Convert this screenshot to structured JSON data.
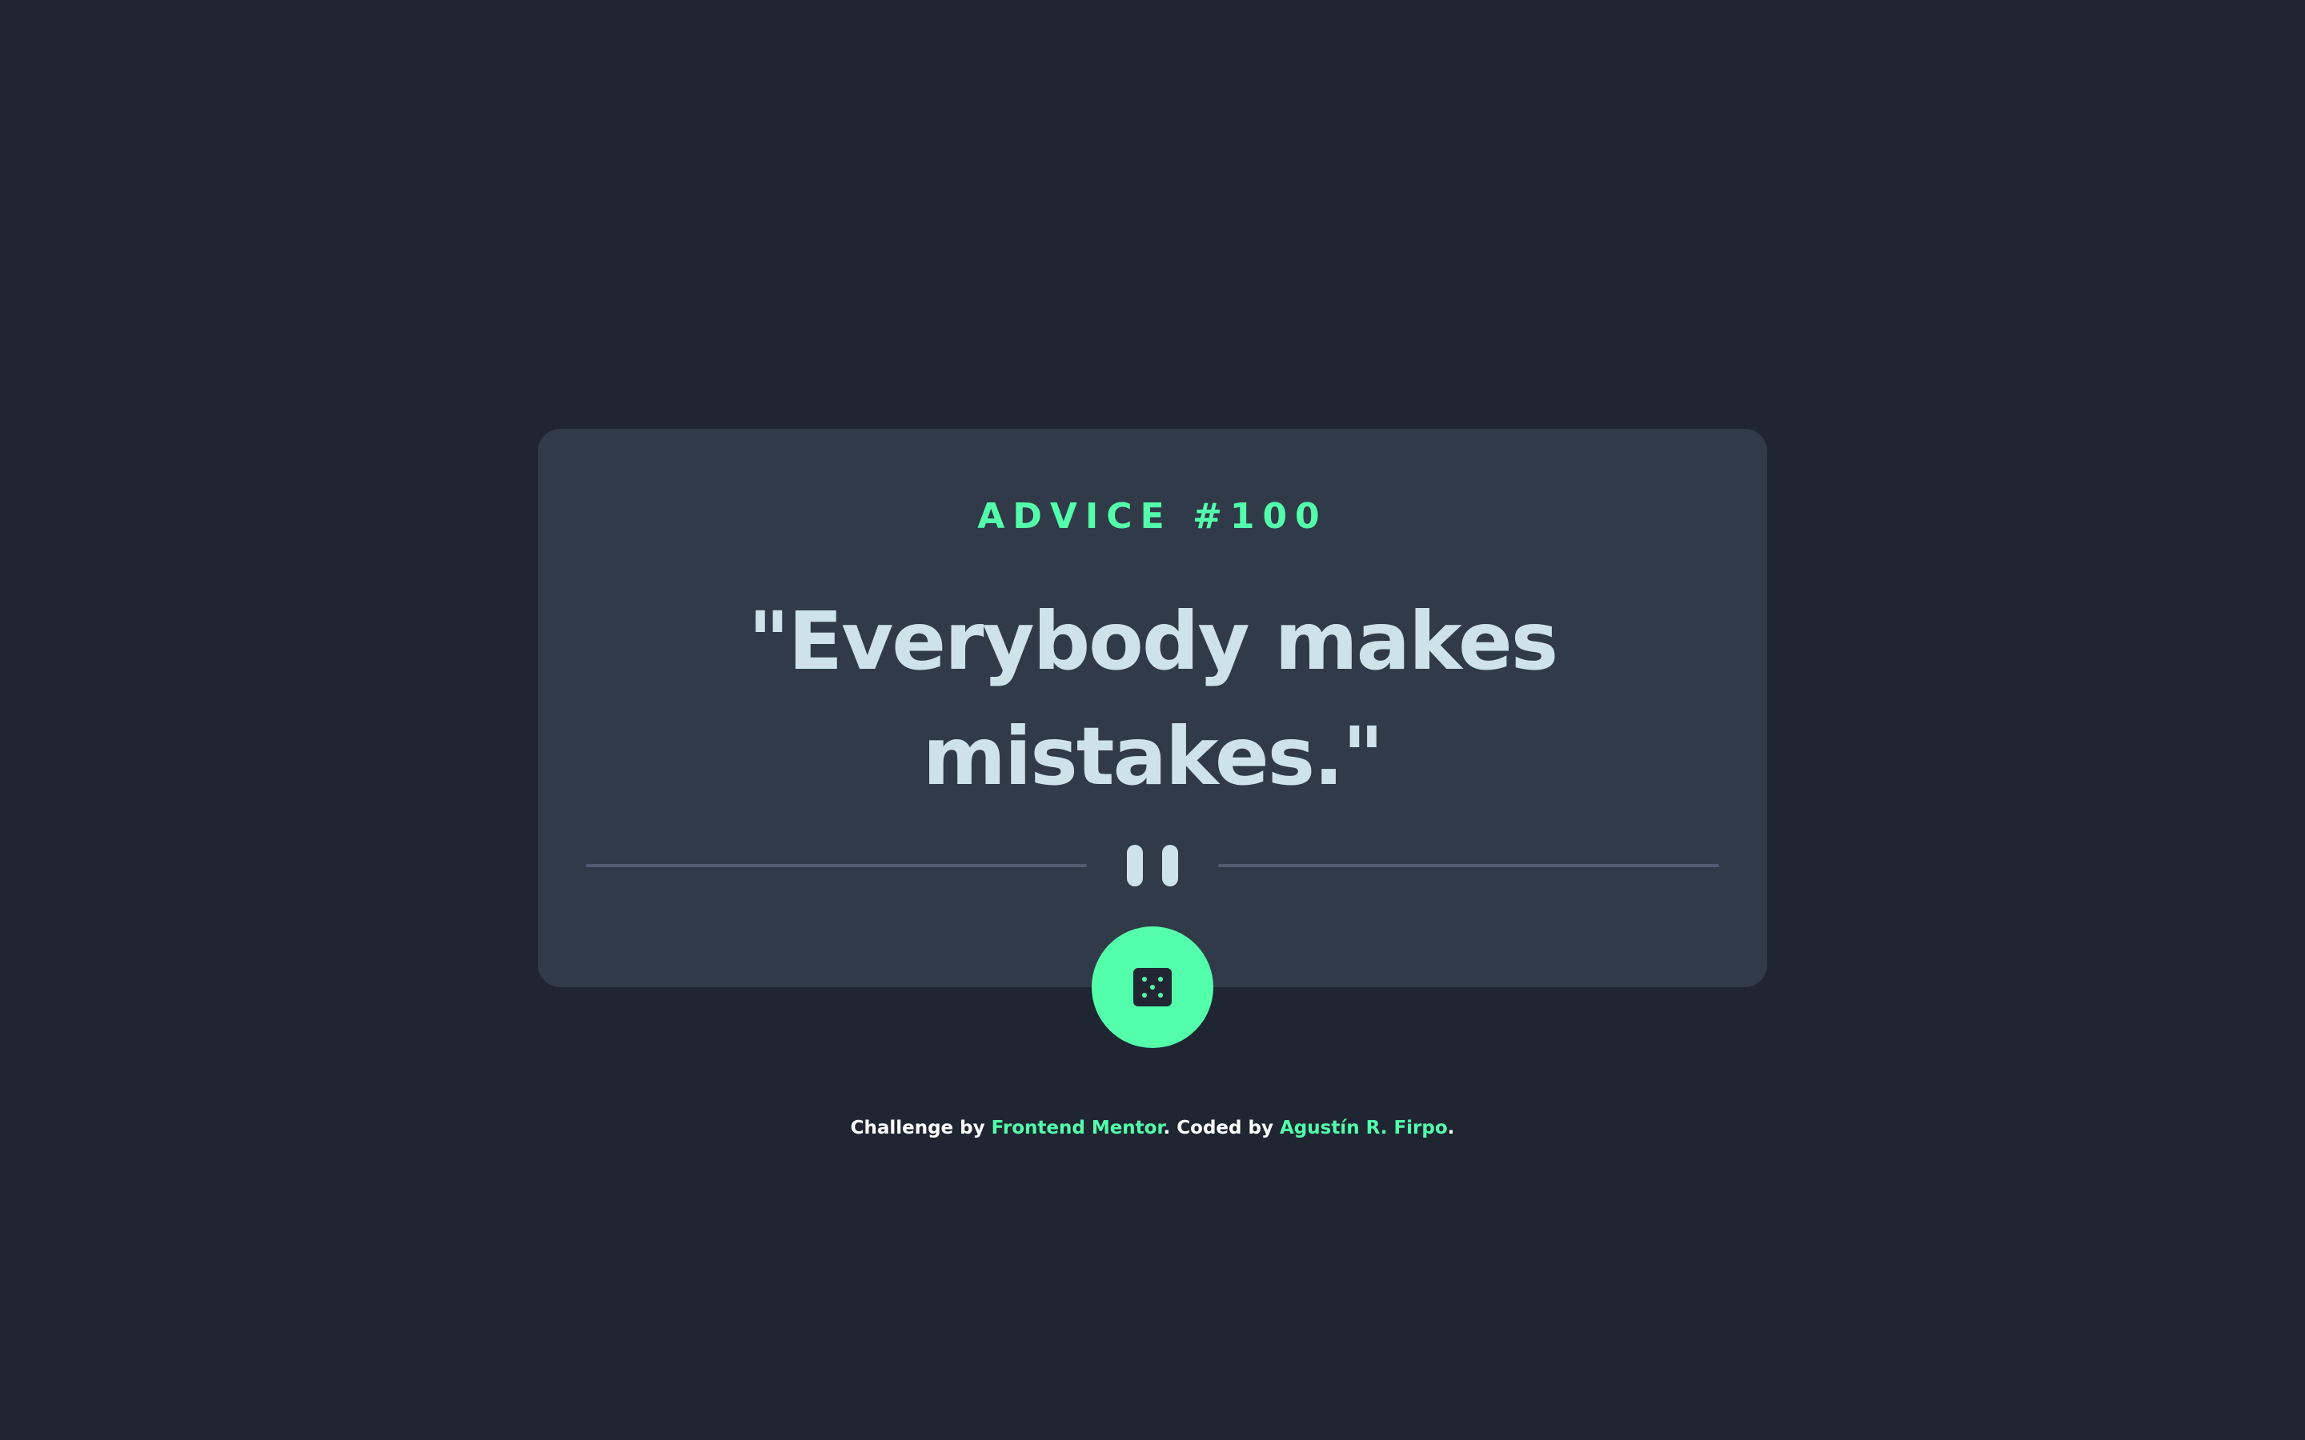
{
  "card": {
    "advice_label": "ADVICE #100",
    "quote": "\"Everybody makes mistakes.\""
  },
  "dice_button": {
    "icon": "dice-icon"
  },
  "footer": {
    "challenge_prefix": "Challenge by ",
    "frontend_mentor_link": "Frontend Mentor",
    "coded_by_text": ". Coded by ",
    "author_link": "Agustín R. Firpo",
    "end_period": "."
  },
  "colors": {
    "background": "#1f2632",
    "card": "#313a49",
    "accent": "#53ffab",
    "quote_text": "#cee3e9",
    "divider": "#4f5d74"
  }
}
